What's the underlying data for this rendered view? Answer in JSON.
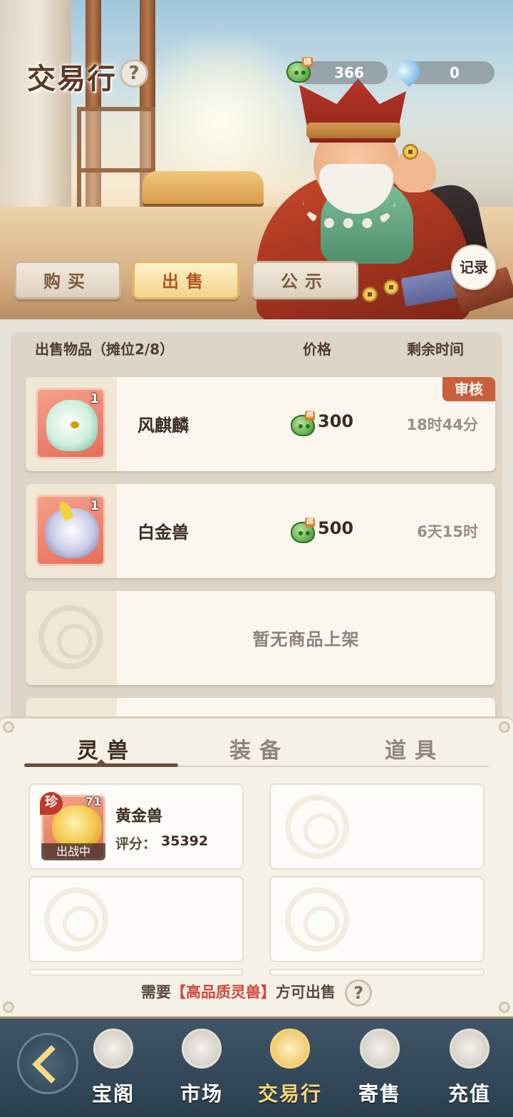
{
  "header": {
    "title": "交易行",
    "help_icon": "?",
    "currencies": [
      {
        "icon": "jade-bean-icon",
        "bind_tag": "绑",
        "value": "366"
      },
      {
        "icon": "spirit-drop-icon",
        "value": "0"
      }
    ],
    "record_label": "记录"
  },
  "tabs": [
    {
      "label": "购买",
      "active": false
    },
    {
      "label": "出售",
      "active": true
    },
    {
      "label": "公示",
      "active": false
    }
  ],
  "list": {
    "headers": {
      "item": "出售物品（摊位2/8）",
      "price": "价格",
      "time": "剩余时间"
    },
    "rows": [
      {
        "name": "风麒麟",
        "qty": "1",
        "price": "300",
        "time": "18时44分",
        "price_bind": "绑",
        "tag": "审核"
      },
      {
        "name": "白金兽",
        "qty": "1",
        "price": "500",
        "time": "6天15时",
        "price_bind": "绑"
      },
      {
        "empty_text": "暂无商品上架"
      }
    ]
  },
  "inventory": {
    "tabs": [
      "灵兽",
      "装备",
      "道具"
    ],
    "active_tab": "灵兽",
    "items": [
      {
        "name": "黄金兽",
        "rarity": "珍",
        "level": "71",
        "status": "出战中",
        "score_label": "评分：",
        "score": "35392"
      }
    ],
    "notice_prefix": "需要",
    "notice_highlight": "【高品质灵兽】",
    "notice_suffix": "方可出售",
    "notice_help": "?"
  },
  "nav": {
    "items": [
      {
        "label": "宝阁",
        "icon": "pavilion-icon"
      },
      {
        "label": "市场",
        "icon": "coin-icon"
      },
      {
        "label": "交易行",
        "icon": "scales-icon",
        "active": true
      },
      {
        "label": "寄售",
        "icon": "consign-scroll-icon"
      },
      {
        "label": "充值",
        "icon": "cloud-icon"
      }
    ]
  },
  "colors": {
    "accent": "#b4551f",
    "highlight": "#d1463b",
    "nav_bg": "#3e5668",
    "review_tag": "#c8613b"
  }
}
